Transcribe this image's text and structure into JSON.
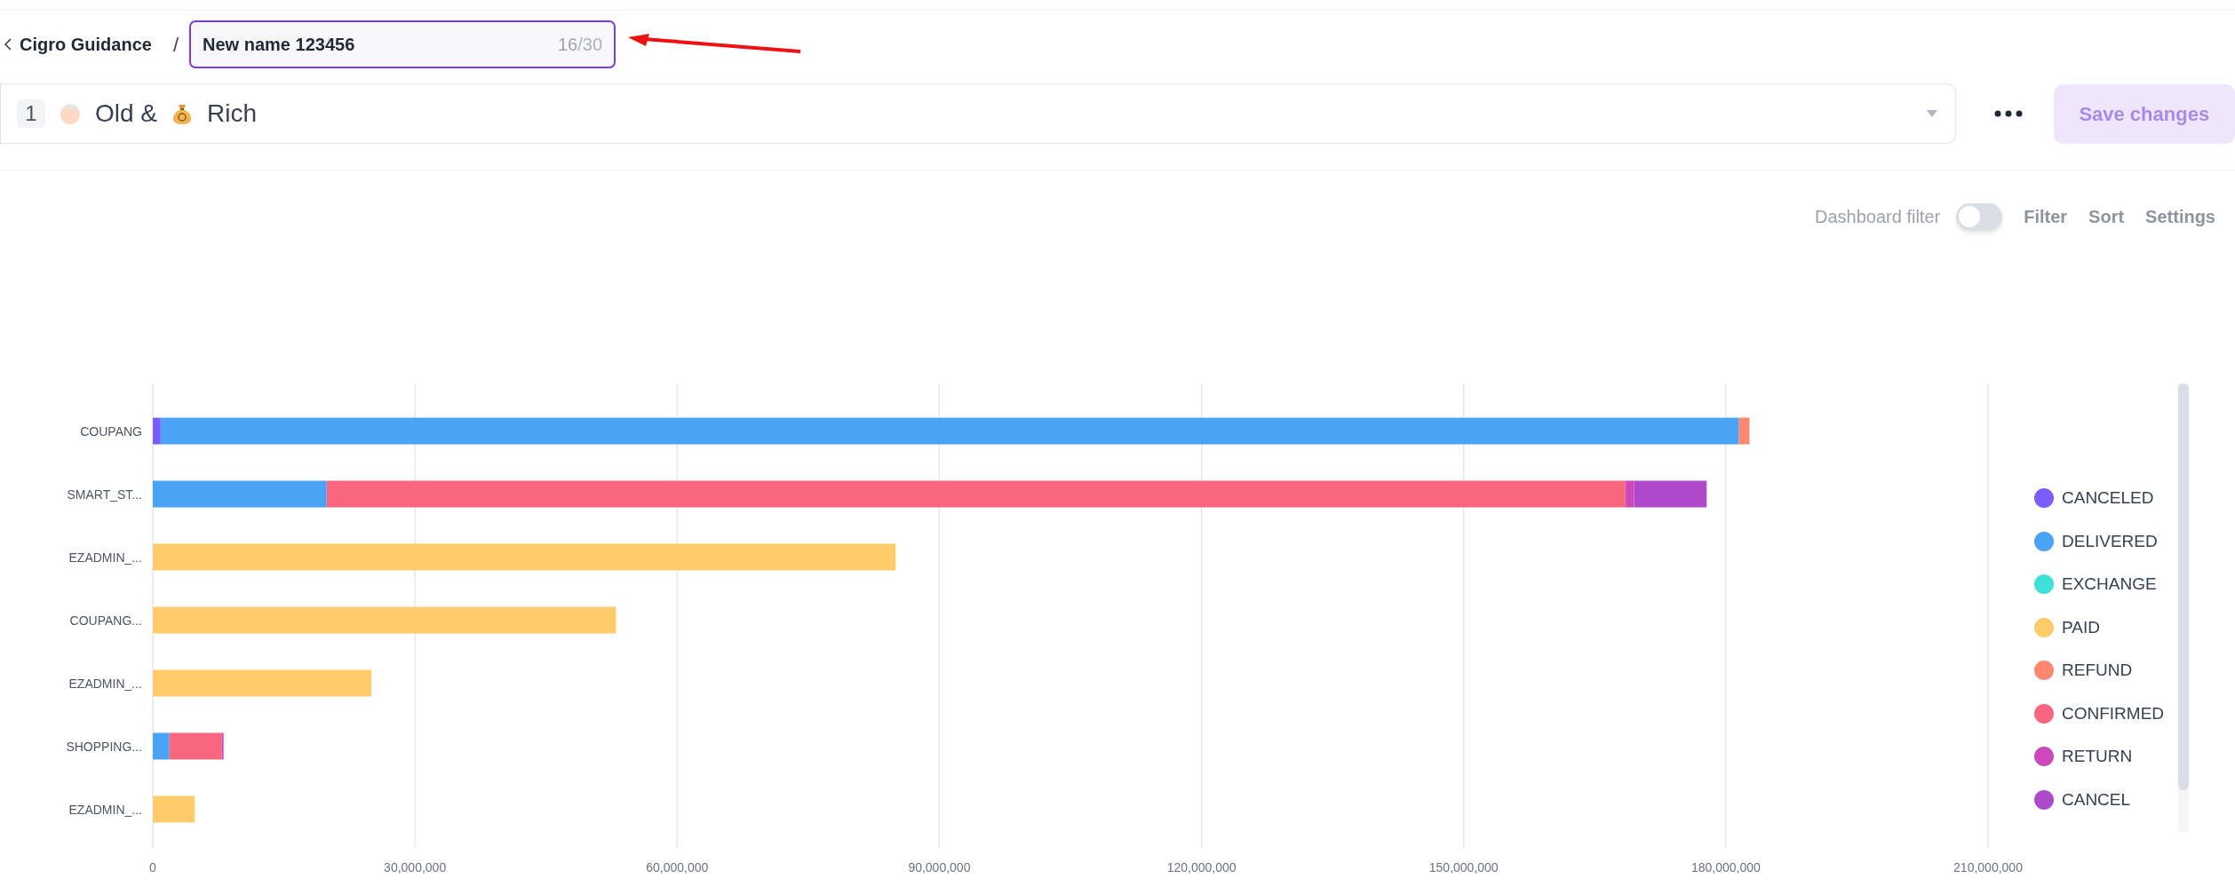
{
  "breadcrumb": {
    "back_label": "Cigro Guidance",
    "separator": "/"
  },
  "name_field": {
    "value": "New name 123456",
    "counter_current": "16",
    "counter_max": "/30",
    "focused": true
  },
  "selector": {
    "index": "1",
    "title_parts": [
      "Old &",
      "Rich"
    ]
  },
  "save_button": {
    "label": "Save changes",
    "disabled": true
  },
  "toolbar": {
    "dashboard_filter": {
      "label": "Dashboard filter",
      "on": false
    },
    "actions": [
      "Filter",
      "Sort",
      "Settings"
    ]
  },
  "chart": {
    "chart_data": {
      "type": "bar",
      "orientation": "horizontal",
      "stacked": true,
      "categories": [
        "COUPANG",
        "SMART_ST...",
        "EZADMIN_...",
        "COUPANG...",
        "EZADMIN_...",
        "SHOPPING...",
        "EZADMIN_..."
      ],
      "xlim": [
        0,
        210000000
      ],
      "grid": true,
      "legend": true,
      "xticks": [
        {
          "value": 0,
          "label": "0"
        },
        {
          "value": 30000000,
          "label": "30,000,000"
        },
        {
          "value": 60000000,
          "label": "60,000,000"
        },
        {
          "value": 90000000,
          "label": "90,000,000"
        },
        {
          "value": 120000000,
          "label": "120,000,000"
        },
        {
          "value": 150000000,
          "label": "150,000,000"
        },
        {
          "value": 180000000,
          "label": "180,000,000"
        },
        {
          "value": 210000000,
          "label": "210,000,000"
        }
      ],
      "series": [
        {
          "name": "CANCELED",
          "color": "#7b5cff",
          "values": [
            900000,
            0,
            0,
            0,
            0,
            0,
            0
          ]
        },
        {
          "name": "DELIVERED",
          "color": "#4ba3f5",
          "values": [
            180600000,
            19900000,
            0,
            0,
            0,
            1900000,
            0
          ]
        },
        {
          "name": "EXCHANGE",
          "color": "#40e0d8",
          "values": [
            0,
            0,
            0,
            0,
            0,
            0,
            0
          ]
        },
        {
          "name": "PAID",
          "color": "#ffcb6b",
          "values": [
            0,
            0,
            85000000,
            53000000,
            25000000,
            0,
            4800000
          ]
        },
        {
          "name": "REFUND",
          "color": "#ff8670",
          "values": [
            1200000,
            0,
            0,
            0,
            0,
            0,
            0
          ]
        },
        {
          "name": "CONFIRMED",
          "color": "#f9667f",
          "values": [
            0,
            148600000,
            0,
            0,
            0,
            6000000,
            0
          ]
        },
        {
          "name": "RETURN",
          "color": "#cc48bb",
          "values": [
            0,
            1000000,
            0,
            0,
            0,
            200000,
            0
          ]
        },
        {
          "name": "CANCEL",
          "color": "#b04acd",
          "values": [
            0,
            8300000,
            0,
            0,
            0,
            0,
            0
          ]
        }
      ]
    }
  }
}
